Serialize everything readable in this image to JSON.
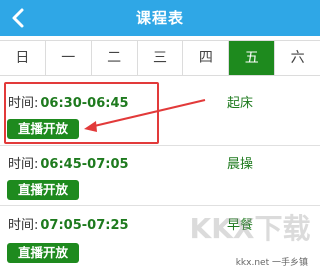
{
  "header": {
    "title": "课程表"
  },
  "weekdays": [
    "日",
    "一",
    "二",
    "三",
    "四",
    "五",
    "六"
  ],
  "active_day_index": 5,
  "schedule": [
    {
      "time_label": "时间:",
      "time": "06:30-06:45",
      "event": "起床",
      "action": "直播开放"
    },
    {
      "time_label": "时间:",
      "time": "06:45-07:05",
      "event": "晨操",
      "action": "直播开放"
    },
    {
      "time_label": "时间:",
      "time": "07:05-07:25",
      "event": "早餐",
      "action": "直播开放"
    }
  ],
  "watermark": {
    "logo_text": "KKX下载",
    "site": "kkx.net",
    "caption": "一手乡镇"
  },
  "colors": {
    "header": "#2fa7e6",
    "accent_green": "#1e8a1e",
    "highlight_red": "#e23a3a"
  }
}
